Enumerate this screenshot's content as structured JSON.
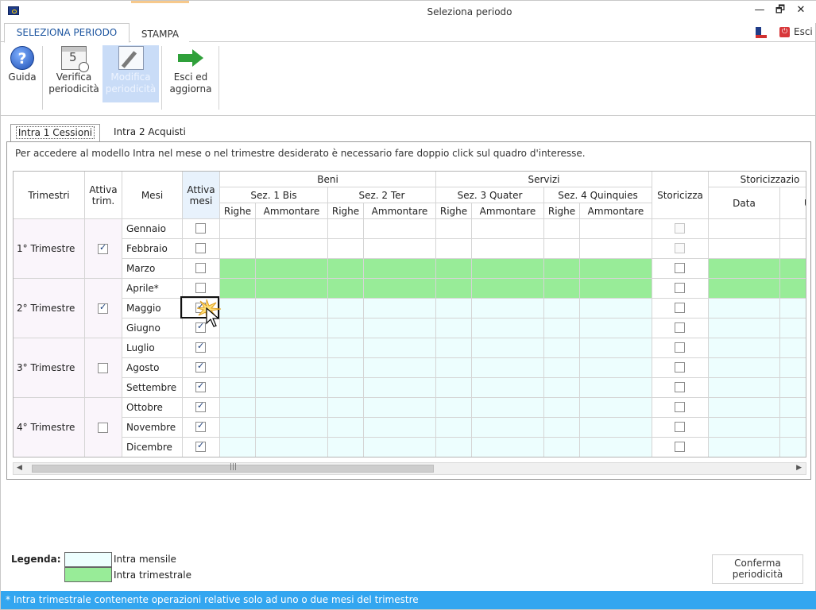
{
  "window": {
    "title": "Seleziona periodo",
    "restore_glyph": "🗗",
    "close_glyph": "✕",
    "minimize_glyph": "—"
  },
  "ribbon": {
    "tabs": [
      "SELEZIONA PERIODO",
      "STAMPA"
    ],
    "esci_label": "Esci"
  },
  "toolbar": {
    "guida": "Guida",
    "verifica_1": "Verifica",
    "verifica_2": "periodicità",
    "modifica_1": "Modifica",
    "modifica_2": "periodicità",
    "esci_1": "Esci ed",
    "esci_2": "aggiorna",
    "help_glyph": "?",
    "calendar_number": "5"
  },
  "inner_tabs": [
    "Intra 1 Cessioni",
    "Intra 2 Acquisti"
  ],
  "instruction": "Per accedere al modello Intra nel mese o nel trimestre desiderato è necessario fare doppio click sul quadro d'interesse.",
  "grid": {
    "headers": {
      "trimestri": "Trimestri",
      "attiva_trim_1": "Attiva",
      "attiva_trim_2": "trim.",
      "mesi": "Mesi",
      "attiva_mesi_1": "Attiva",
      "attiva_mesi_2": "mesi",
      "beni": "Beni",
      "servizi": "Servizi",
      "storicizza": "Storicizza",
      "storicizzazione": "Storicizzazio",
      "sez1": "Sez. 1 Bis",
      "sez2": "Sez. 2 Ter",
      "sez3": "Sez. 3 Quater",
      "sez4": "Sez. 4 Quinquies",
      "righe": "Righe",
      "ammontare": "Ammontare",
      "data": "Data",
      "u": "U"
    },
    "quarters": [
      {
        "label": "1° Trimestre",
        "active": true
      },
      {
        "label": "2° Trimestre",
        "active": true
      },
      {
        "label": "3° Trimestre",
        "active": false
      },
      {
        "label": "4° Trimestre",
        "active": false
      }
    ],
    "months": [
      {
        "name": "Gennaio",
        "checked": false,
        "type": "none",
        "storicizza_disabled": true
      },
      {
        "name": "Febbraio",
        "checked": false,
        "type": "none",
        "storicizza_disabled": true
      },
      {
        "name": "Marzo",
        "checked": false,
        "type": "trimestrale",
        "storicizza_disabled": false
      },
      {
        "name": "Aprile*",
        "checked": false,
        "type": "trimestrale",
        "storicizza_disabled": false
      },
      {
        "name": "Maggio",
        "checked": true,
        "type": "mensile",
        "storicizza_disabled": false
      },
      {
        "name": "Giugno",
        "checked": true,
        "type": "mensile",
        "storicizza_disabled": false
      },
      {
        "name": "Luglio",
        "checked": true,
        "type": "mensile",
        "storicizza_disabled": false
      },
      {
        "name": "Agosto",
        "checked": true,
        "type": "mensile",
        "storicizza_disabled": false
      },
      {
        "name": "Settembre",
        "checked": true,
        "type": "mensile",
        "storicizza_disabled": false
      },
      {
        "name": "Ottobre",
        "checked": true,
        "type": "mensile",
        "storicizza_disabled": false
      },
      {
        "name": "Novembre",
        "checked": true,
        "type": "mensile",
        "storicizza_disabled": false
      },
      {
        "name": "Dicembre",
        "checked": true,
        "type": "mensile",
        "storicizza_disabled": false
      }
    ],
    "scroll_grip": "|||",
    "scroll_left": "◀",
    "scroll_right": "▶"
  },
  "legend": {
    "title": "Legenda:",
    "mensile": "Intra mensile",
    "trimestrale": "Intra trimestrale"
  },
  "confirm_button_1": "Conferma",
  "confirm_button_2": "periodicità",
  "status_text": "* Intra trimestrale contenente operazioni relative solo ad uno o due mesi del trimestre",
  "colors": {
    "mensile": "#edfefe",
    "trimestrale": "#98ec98",
    "quarter_header_bg": "#faf5fb",
    "attiva_mesi_header_bg": "#e8f2fc",
    "status_bar": "#33a6f0",
    "ribbon_tab_active_text": "#1e56a0"
  }
}
